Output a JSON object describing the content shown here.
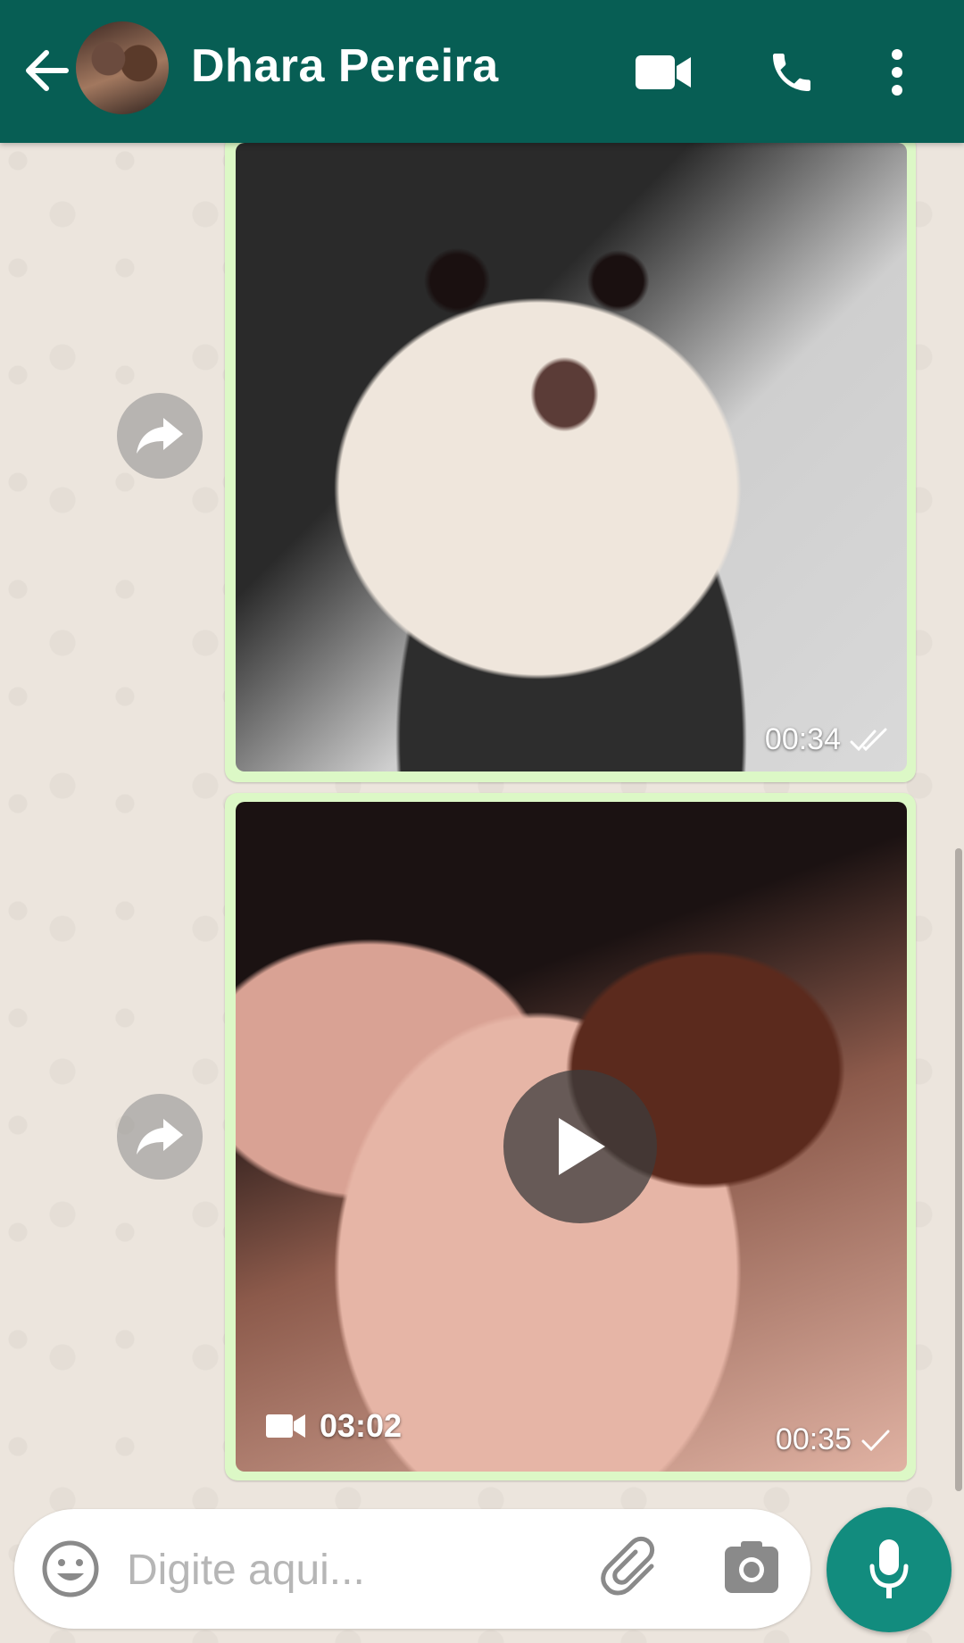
{
  "header": {
    "contact_name": "Dhara Pereira",
    "back_icon": "arrow-left-icon",
    "video_call_icon": "video-camera-icon",
    "voice_call_icon": "phone-icon",
    "menu_icon": "more-vertical-icon",
    "bg_color": "#075e54"
  },
  "messages": [
    {
      "type": "image",
      "time": "00:34",
      "status": "read",
      "status_icon": "double-check-icon"
    },
    {
      "type": "video",
      "duration": "03:02",
      "time": "00:35",
      "status": "sent",
      "status_icon": "single-check-icon"
    }
  ],
  "composer": {
    "placeholder": "Digite aqui...",
    "emoji_icon": "emoji-icon",
    "attach_icon": "paperclip-icon",
    "camera_icon": "camera-icon",
    "mic_icon": "microphone-icon",
    "accent_color": "#128c7e"
  },
  "colors": {
    "bubble_out": "#dcf8c6",
    "wallpaper": "#ece5dd"
  }
}
